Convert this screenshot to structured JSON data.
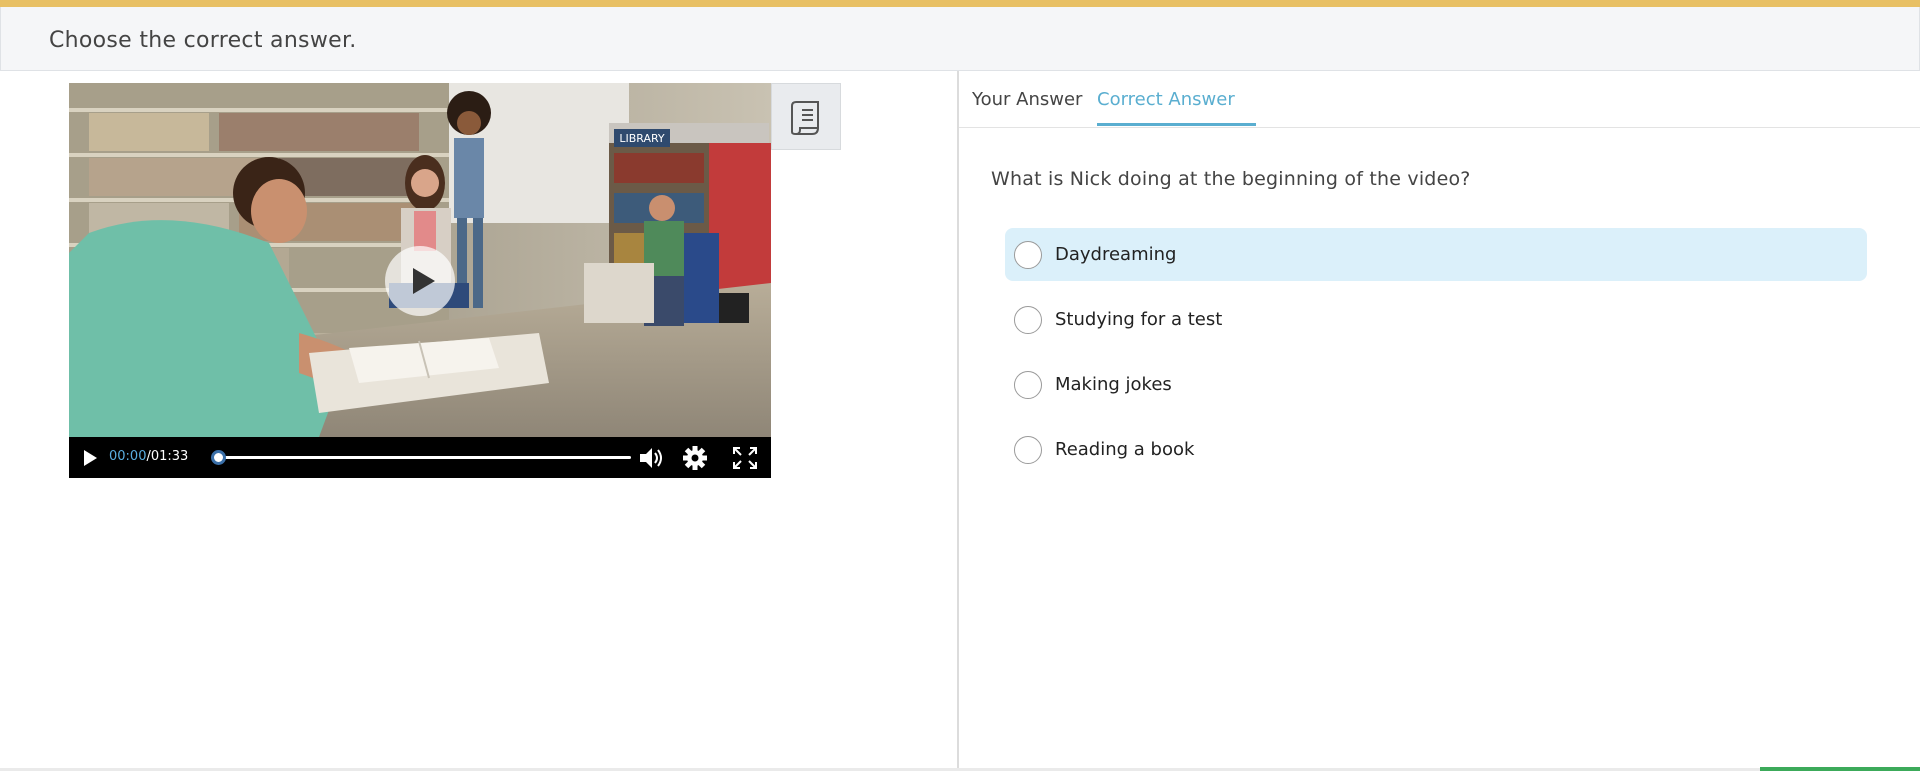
{
  "header": {
    "instruction": "Choose the correct answer.",
    "accent_color": "#e8c064"
  },
  "video": {
    "current_time": "00:00",
    "separator": "/",
    "duration": "01:33",
    "progress_fraction": 0,
    "scene_sign": "LIBRARY",
    "controls_icons": [
      "play-icon",
      "volume-icon",
      "settings-gear-icon",
      "fullscreen-icon"
    ],
    "overlay_icon": "play-icon"
  },
  "transcript_button": {
    "icon": "transcript-scroll-icon"
  },
  "tabs": [
    {
      "label": "Your Answer",
      "active": false
    },
    {
      "label": "Correct Answer",
      "active": true
    }
  ],
  "question": {
    "text": "What is Nick doing at the beginning of the video?",
    "options": [
      {
        "label": "Daydreaming",
        "highlighted": true
      },
      {
        "label": "Studying for a test",
        "highlighted": false
      },
      {
        "label": "Making jokes",
        "highlighted": false
      },
      {
        "label": "Reading a book",
        "highlighted": false
      }
    ]
  },
  "colors": {
    "tab_active": "#5aaed0",
    "highlight_bg": "#dbf0fa",
    "time_current": "#5aaee0"
  }
}
